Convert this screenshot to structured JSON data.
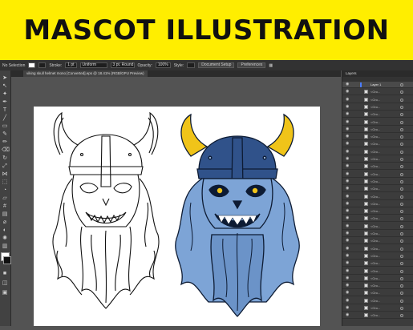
{
  "banner": {
    "title": "MASCOT ILLUSTRATION"
  },
  "control_bar": {
    "selection": "No Selection",
    "stroke_label": "Stroke:",
    "stroke_weight": "1 pt",
    "uniform": "Uniform",
    "brush": "3 pt. Round",
    "opacity_label": "Opacity:",
    "opacity": "100%",
    "style_label": "Style:",
    "document_setup": "Document Setup",
    "preferences": "Preferences"
  },
  "document_tab": {
    "label": "viking skull helmet mono [Converted].eps @ 18.41% (RGB/GPU Preview)"
  },
  "layers_panel": {
    "title": "Layers",
    "parent_layer": "Layer 1",
    "sublayer_label": "<Gro..."
  },
  "colors": {
    "banner": "#ffee00",
    "chrome": "#535353",
    "helmet": "#30528a",
    "skull": "#7da4d6",
    "horn": "#f0c419",
    "outline": "#0d1b33"
  }
}
